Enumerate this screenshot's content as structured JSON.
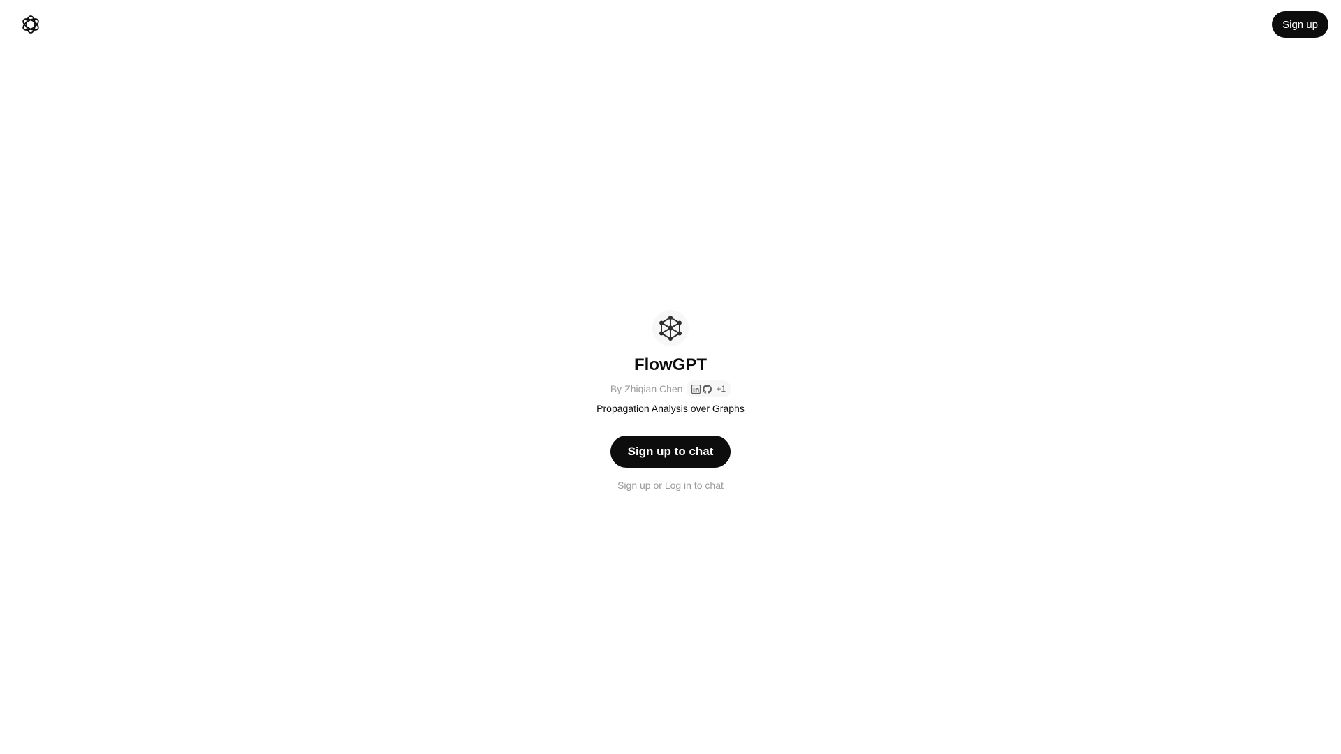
{
  "header": {
    "logo_icon": "openai-logo-icon",
    "signup_label": "Sign up"
  },
  "gpt": {
    "avatar_icon": "network-graph-icon",
    "name": "FlowGPT",
    "by_prefix": "By",
    "author": "Zhiqian Chen",
    "social_icons": [
      "linkedin-icon",
      "github-icon"
    ],
    "extra_links": "+1",
    "description": "Propagation Analysis over Graphs"
  },
  "cta": {
    "label": "Sign up to chat"
  },
  "footer": {
    "signup_link": "Sign up",
    "or": "or",
    "login_link": "Log in",
    "suffix": "to chat"
  },
  "colors": {
    "button_bg": "#0d0d0d",
    "muted_text": "#9b9b9b",
    "background": "#ffffff"
  }
}
